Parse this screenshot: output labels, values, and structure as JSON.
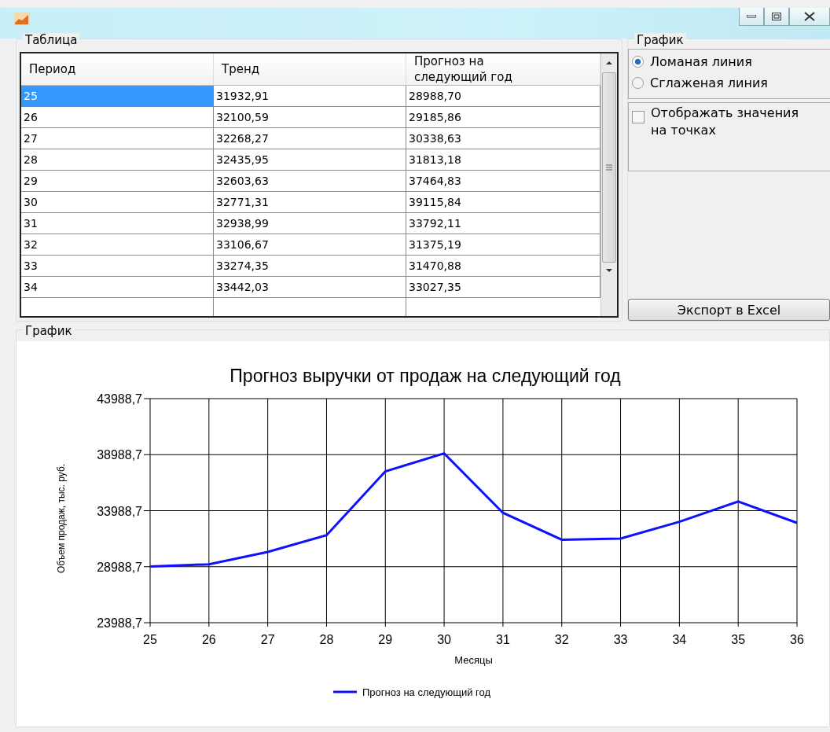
{
  "table_group": {
    "title": "Таблица"
  },
  "table": {
    "columns": [
      "Период",
      "Тренд",
      "Прогноз на следующий год"
    ],
    "rows": [
      {
        "cells": [
          "25",
          "31932,91",
          "28988,70"
        ],
        "selected": true
      },
      {
        "cells": [
          "26",
          "32100,59",
          "29185,86"
        ],
        "selected": false
      },
      {
        "cells": [
          "27",
          "32268,27",
          "30338,63"
        ],
        "selected": false
      },
      {
        "cells": [
          "28",
          "32435,95",
          "31813,18"
        ],
        "selected": false
      },
      {
        "cells": [
          "29",
          "32603,63",
          "37464,83"
        ],
        "selected": false
      },
      {
        "cells": [
          "30",
          "32771,31",
          "39115,84"
        ],
        "selected": false
      },
      {
        "cells": [
          "31",
          "32938,99",
          "33792,11"
        ],
        "selected": false
      },
      {
        "cells": [
          "32",
          "33106,67",
          "31375,19"
        ],
        "selected": false
      },
      {
        "cells": [
          "33",
          "33274,35",
          "31470,88"
        ],
        "selected": false
      },
      {
        "cells": [
          "34",
          "33442,03",
          "33027,35"
        ],
        "selected": false
      }
    ]
  },
  "options_group": {
    "title": "График",
    "radios": [
      {
        "label": "Ломаная линия",
        "selected": true
      },
      {
        "label": "Сглаженая линия",
        "selected": false
      }
    ],
    "checkbox": {
      "label": "Отображать значения на точках",
      "checked": false
    },
    "export_button": "Экспорт в Excel"
  },
  "chart_group": {
    "title": "График",
    "chart_data": {
      "type": "line",
      "title": "Прогноз выручки от продаж на следующий год",
      "xlabel": "Месяцы",
      "ylabel": "Объем продаж, тыс. руб.",
      "categories": [
        "25",
        "26",
        "27",
        "28",
        "29",
        "30",
        "31",
        "32",
        "33",
        "34",
        "35",
        "36"
      ],
      "series": [
        {
          "name": "Прогноз на следующий год",
          "color": "#1010ff",
          "values": [
            29000,
            29200,
            30300,
            31800,
            37500,
            39100,
            33800,
            31400,
            31500,
            33000,
            34800,
            32900
          ]
        }
      ],
      "grid": true,
      "ylim": [
        23988.7,
        43988.7
      ],
      "yticks": [
        {
          "value": 23988.7,
          "label": "23988,7"
        },
        {
          "value": 28988.7,
          "label": "28988,7"
        },
        {
          "value": 33988.7,
          "label": "33988,7"
        },
        {
          "value": 38988.7,
          "label": "38988,7"
        },
        {
          "value": 43988.7,
          "label": "43988,7"
        }
      ]
    }
  }
}
